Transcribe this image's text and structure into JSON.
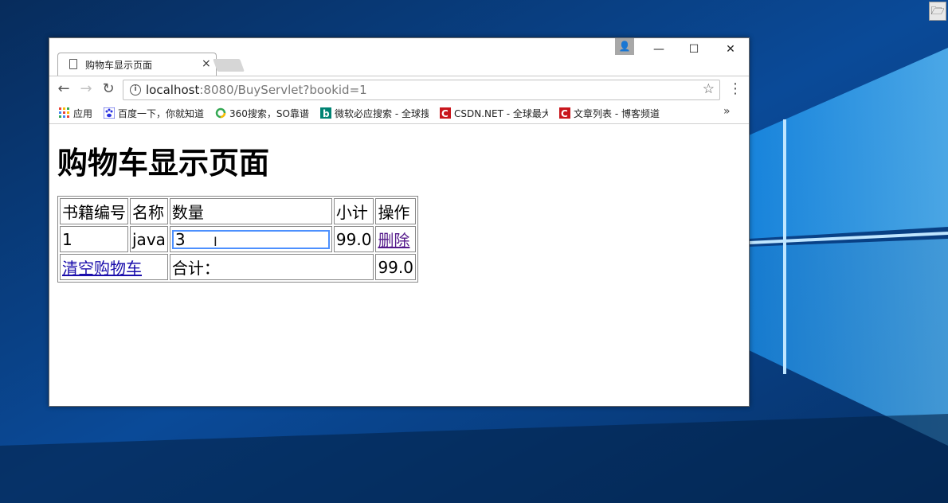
{
  "browser": {
    "tab_title": "购物车显示页面",
    "tab_close": "×",
    "url_host": "localhost",
    "url_rest": ":8080/BuyServlet?bookid=1",
    "bookmarks": [
      {
        "label": "应用",
        "icon": "apps-grid-icon"
      },
      {
        "label": "百度一下，你就知道",
        "icon": "baidu-paw-icon"
      },
      {
        "label": "360搜索，SO靠谱",
        "icon": "360-search-icon"
      },
      {
        "label": "微软必应搜索 - 全球搜",
        "icon": "bing-icon"
      },
      {
        "label": "CSDN.NET - 全球最大",
        "icon": "csdn-icon"
      },
      {
        "label": "文章列表 - 博客频道",
        "icon": "csdn-icon"
      }
    ],
    "more": "»"
  },
  "page": {
    "heading": "购物车显示页面",
    "table": {
      "headers": [
        "书籍编号",
        "名称",
        "数量",
        "小计",
        "操作"
      ],
      "row": {
        "id": "1",
        "name": "java",
        "quantity": "3",
        "subtotal": "99.0",
        "action": "删除"
      },
      "footer": {
        "clear_link": "清空购物车",
        "total_label": "合计：",
        "total": "99.0"
      }
    }
  },
  "colors": {
    "link": "#1a0dab",
    "visited_link": "#551a8b",
    "focus_border": "#4d90fe"
  }
}
